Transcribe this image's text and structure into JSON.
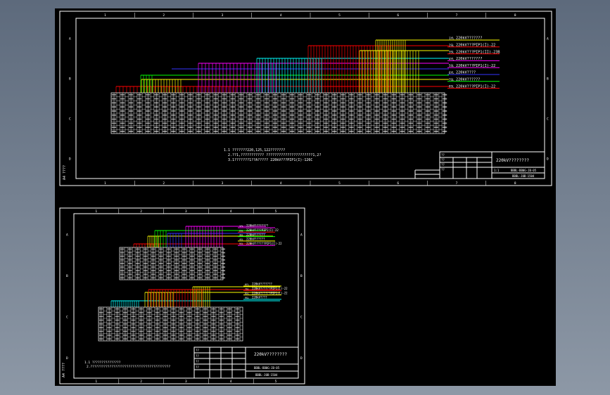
{
  "colors": {
    "background": "#000000",
    "desktop_top": "#5d6a7c",
    "desktop_bottom": "#8d98a6",
    "frame": "#ffffff",
    "red": "#ff0000",
    "yellow": "#ffff00",
    "green": "#00ff00",
    "blue": "#3333ff",
    "magenta": "#ff00ff",
    "cyan": "#00ffff"
  },
  "sheet1": {
    "col_labels": [
      "1",
      "2",
      "3",
      "4",
      "5",
      "6",
      "7",
      "8"
    ],
    "row_labels": [
      "A",
      "B",
      "C",
      "D"
    ],
    "legend": [
      {
        "code": "1YL",
        "text": "220kV???????",
        "color": "#ffff00"
      },
      {
        "code": "2SL",
        "text": "220kV???PIP1(I)-22",
        "color": "#ff0000"
      },
      {
        "code": "3SL",
        "text": "220kV???PIP1(II)-23B",
        "color": "#ff0000"
      },
      {
        "code": "4YL",
        "text": "220kV???????",
        "color": "#ff00ff"
      },
      {
        "code": "5SL",
        "text": "220kV???PIP1(I)-22",
        "color": "#ff00ff"
      },
      {
        "code": "6YL",
        "text": "220kV????",
        "color": "#3333ff"
      },
      {
        "code": "7SL",
        "text": "220kV??????",
        "color": "#00ff00"
      },
      {
        "code": "8SL",
        "text": "220kV???PIP1(I)-22",
        "color": "#ff0000"
      }
    ],
    "notes": [
      "1.1 ???????220,125,122???????",
      "2.??1,???????????  ??????????????????????1,2?",
      "3.1???????1??A????? 220kV???PIP1(I)-126C"
    ],
    "title_block": {
      "title": "220kV????????",
      "drawing_no": "BBBL-BB0G-JB-05",
      "sheet_no": "BBBL-J0B-1504",
      "scale": "1:1",
      "rows": [
        "??",
        "??",
        "??",
        "??"
      ],
      "side_tag": "A4 ????"
    }
  },
  "sheet2": {
    "col_labels": [
      "1",
      "2",
      "3",
      "4",
      "5"
    ],
    "row_labels": [
      "A",
      "B",
      "C",
      "D"
    ],
    "legend_top": [
      {
        "code": "1YL",
        "text": "220kV????????",
        "color": "#ff00ff"
      },
      {
        "code": "2SL",
        "text": "220kV????PIP1(I)-22",
        "color": "#ff0000"
      },
      {
        "code": "3SL",
        "text": "220kV??????",
        "color": "#00ff00"
      },
      {
        "code": "4SL",
        "text": "220kV??????",
        "color": "#ffff00"
      },
      {
        "code": "5SL",
        "text": "220kV??????PIP1(I)-22",
        "color": "#ff00ff"
      }
    ],
    "legend_bottom": [
      {
        "code": "6YL",
        "text": "220kV???????",
        "color": "#ffff00"
      },
      {
        "code": "7SL",
        "text": "220kV??????PIP1(I)-22",
        "color": "#ff0000"
      },
      {
        "code": "8SL",
        "text": "220kV??????PIP1(I)-22",
        "color": "#ffff00"
      },
      {
        "code": "9SL",
        "text": "220kV????",
        "color": "#00ffff"
      }
    ],
    "notes": [
      "1.1 ???????????????",
      "2.??????????????????????????????????????????"
    ],
    "title_block": {
      "title": "220kV????????",
      "drawing_no": "BBBL-BB0G-JB-05",
      "sheet_no": "BBBL-J0B-1504",
      "rows": [
        "??",
        "??",
        "??",
        "??"
      ],
      "side_tag": "A4 ????"
    }
  }
}
